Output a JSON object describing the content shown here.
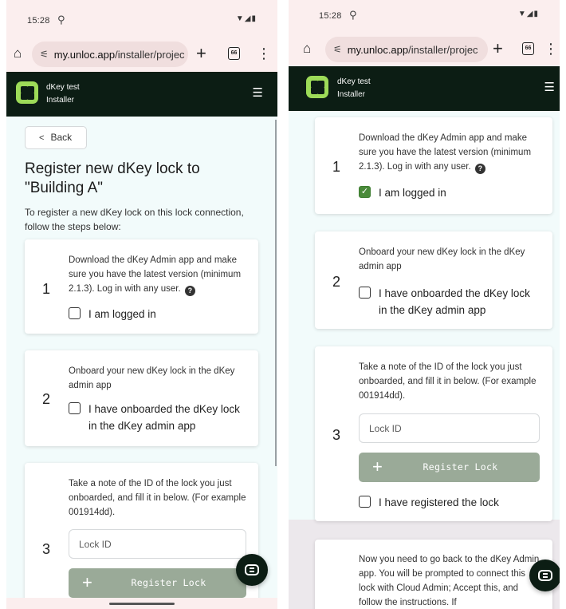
{
  "status": {
    "time": "15:28",
    "extra_icon": "⚲",
    "icons": "▼◢▮"
  },
  "browser": {
    "url_domain": "my.unloc.app",
    "url_path": "/installer/projec",
    "tab_count": "66"
  },
  "header": {
    "title": "dKey test",
    "subtitle": "Installer"
  },
  "page": {
    "back_label": "Back",
    "title": "Register new dKey lock to \"Building A\"",
    "intro": "To register a new dKey lock on this lock connection, follow the steps below:"
  },
  "steps": [
    {
      "number": "1",
      "text": "Download the dKey Admin app and make sure you have the latest version (minimum 2.1.3). Log in with any user.",
      "check_label": "I am logged in",
      "checked_left": false,
      "checked_right": true
    },
    {
      "number": "2",
      "text": "Onboard your new dKey lock in the dKey admin app",
      "check_label": "I have onboarded the dKey lock in the dKey admin app",
      "checked_left": false,
      "checked_right": false
    },
    {
      "number": "3",
      "text": "Take a note of the ID of the lock you just onboarded, and fill it in below. (For example 001914dd).",
      "input_placeholder": "Lock ID",
      "button_label": "Register Lock",
      "check_label": "I have registered the lock",
      "checked": false
    },
    {
      "text_partial": "Now you need to go back to the dKey Admin app. You will be prompted to connect this lock with Cloud Admin; Accept this, and follow the instructions. If"
    }
  ],
  "colors": {
    "header_bg": "#0c1d14",
    "logo": "#9ddb58",
    "content_bg": "#f2fbfb",
    "button_disabled": "#9aaa98",
    "checkbox_checked": "#4a8a3a"
  },
  "icons": {
    "home": "home-icon",
    "site_settings": "site-settings-icon",
    "new_tab": "plus-icon",
    "tabs": "tab-switcher-icon",
    "menu": "more-vertical-icon",
    "hamburger": "hamburger-menu-icon",
    "chat": "chat-icon",
    "help": "question-icon"
  }
}
